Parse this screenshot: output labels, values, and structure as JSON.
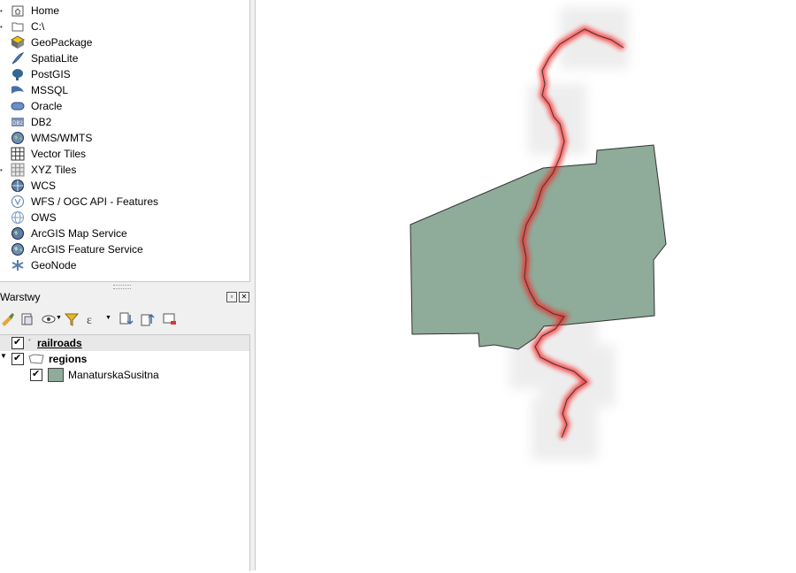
{
  "browser": {
    "items": [
      {
        "label": "Home",
        "icon": "home-folder-icon"
      },
      {
        "label": "C:\\",
        "icon": "drive-folder-icon"
      },
      {
        "label": "GeoPackage",
        "icon": "geopackage-icon"
      },
      {
        "label": "SpatiaLite",
        "icon": "spatialite-icon"
      },
      {
        "label": "PostGIS",
        "icon": "postgis-elephant-icon"
      },
      {
        "label": "MSSQL",
        "icon": "mssql-icon"
      },
      {
        "label": "Oracle",
        "icon": "oracle-icon"
      },
      {
        "label": "DB2",
        "icon": "db2-icon"
      },
      {
        "label": "WMS/WMTS",
        "icon": "wms-globe-icon"
      },
      {
        "label": "Vector Tiles",
        "icon": "vector-tiles-icon"
      },
      {
        "label": "XYZ Tiles",
        "icon": "xyz-tiles-icon"
      },
      {
        "label": "WCS",
        "icon": "wcs-globe-icon"
      },
      {
        "label": "WFS / OGC API - Features",
        "icon": "wfs-globe-icon"
      },
      {
        "label": "OWS",
        "icon": "ows-globe-icon"
      },
      {
        "label": "ArcGIS Map Service",
        "icon": "arcgis-map-icon"
      },
      {
        "label": "ArcGIS Feature Service",
        "icon": "arcgis-feature-icon"
      },
      {
        "label": "GeoNode",
        "icon": "geonode-icon"
      }
    ]
  },
  "layers_panel": {
    "title": "Warstwy",
    "layers": [
      {
        "name": "railroads",
        "checked": true
      },
      {
        "name": "regions",
        "checked": true
      },
      {
        "name": "ManaturskaSusitna",
        "checked": true
      }
    ]
  },
  "colors": {
    "region_fill": "#8fab99",
    "region_stroke": "#333333",
    "railroad_line": "#3a3a3a",
    "railroad_glow": "#ff1a1a"
  }
}
